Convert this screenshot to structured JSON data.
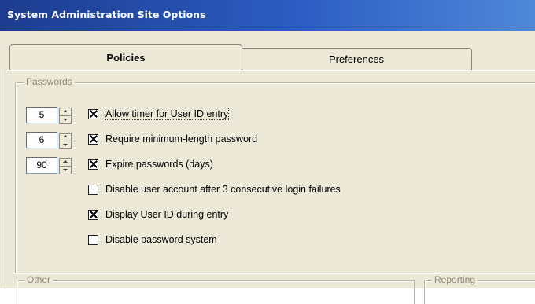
{
  "window": {
    "title": "System Administration Site Options"
  },
  "tabs": [
    {
      "label": "Policies",
      "active": true
    },
    {
      "label": "Preferences",
      "active": false
    }
  ],
  "passwords": {
    "group_label": "Passwords",
    "rows": [
      {
        "spinner_value": "5",
        "checked": true,
        "label": "Allow timer for User ID entry"
      },
      {
        "spinner_value": "6",
        "checked": true,
        "label": "Require minimum-length password"
      },
      {
        "spinner_value": "90",
        "checked": true,
        "label": "Expire passwords (days)"
      },
      {
        "checked": false,
        "label": "Disable user account after 3 consecutive login failures"
      },
      {
        "checked": true,
        "label": "Display User ID during entry"
      },
      {
        "checked": false,
        "label": "Disable password system"
      }
    ]
  },
  "other": {
    "group_label": "Other"
  },
  "reporting": {
    "group_label": "Reporting"
  },
  "colors": {
    "title_gradient_start": "#1d3c8f",
    "title_gradient_end": "#4f88d9",
    "dialog_bg": "#ece9d8"
  }
}
